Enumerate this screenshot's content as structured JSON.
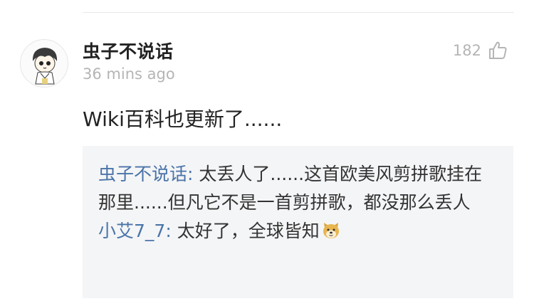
{
  "comment": {
    "username": "虫子不说话",
    "timestamp": "36 mins ago",
    "like_count": "182",
    "text": "Wiki百科也更新了......"
  },
  "replies": [
    {
      "author": "虫子不说话",
      "separator": ": ",
      "text": "太丢人了......这首欧美风剪拼歌挂在那里......但凡它不是一首剪拼歌，都没那么丢人"
    },
    {
      "author": "小艾7_7",
      "separator": ": ",
      "text": "太好了，全球皆知",
      "emoji": "doge-emoji"
    }
  ],
  "icons": {
    "avatar": "cartoon-avatar",
    "like": "thumbs-up-icon"
  },
  "colors": {
    "link": "#4a74a8",
    "muted": "#b5b5b5",
    "text": "#222222",
    "reply_bg": "#f4f5f7"
  }
}
